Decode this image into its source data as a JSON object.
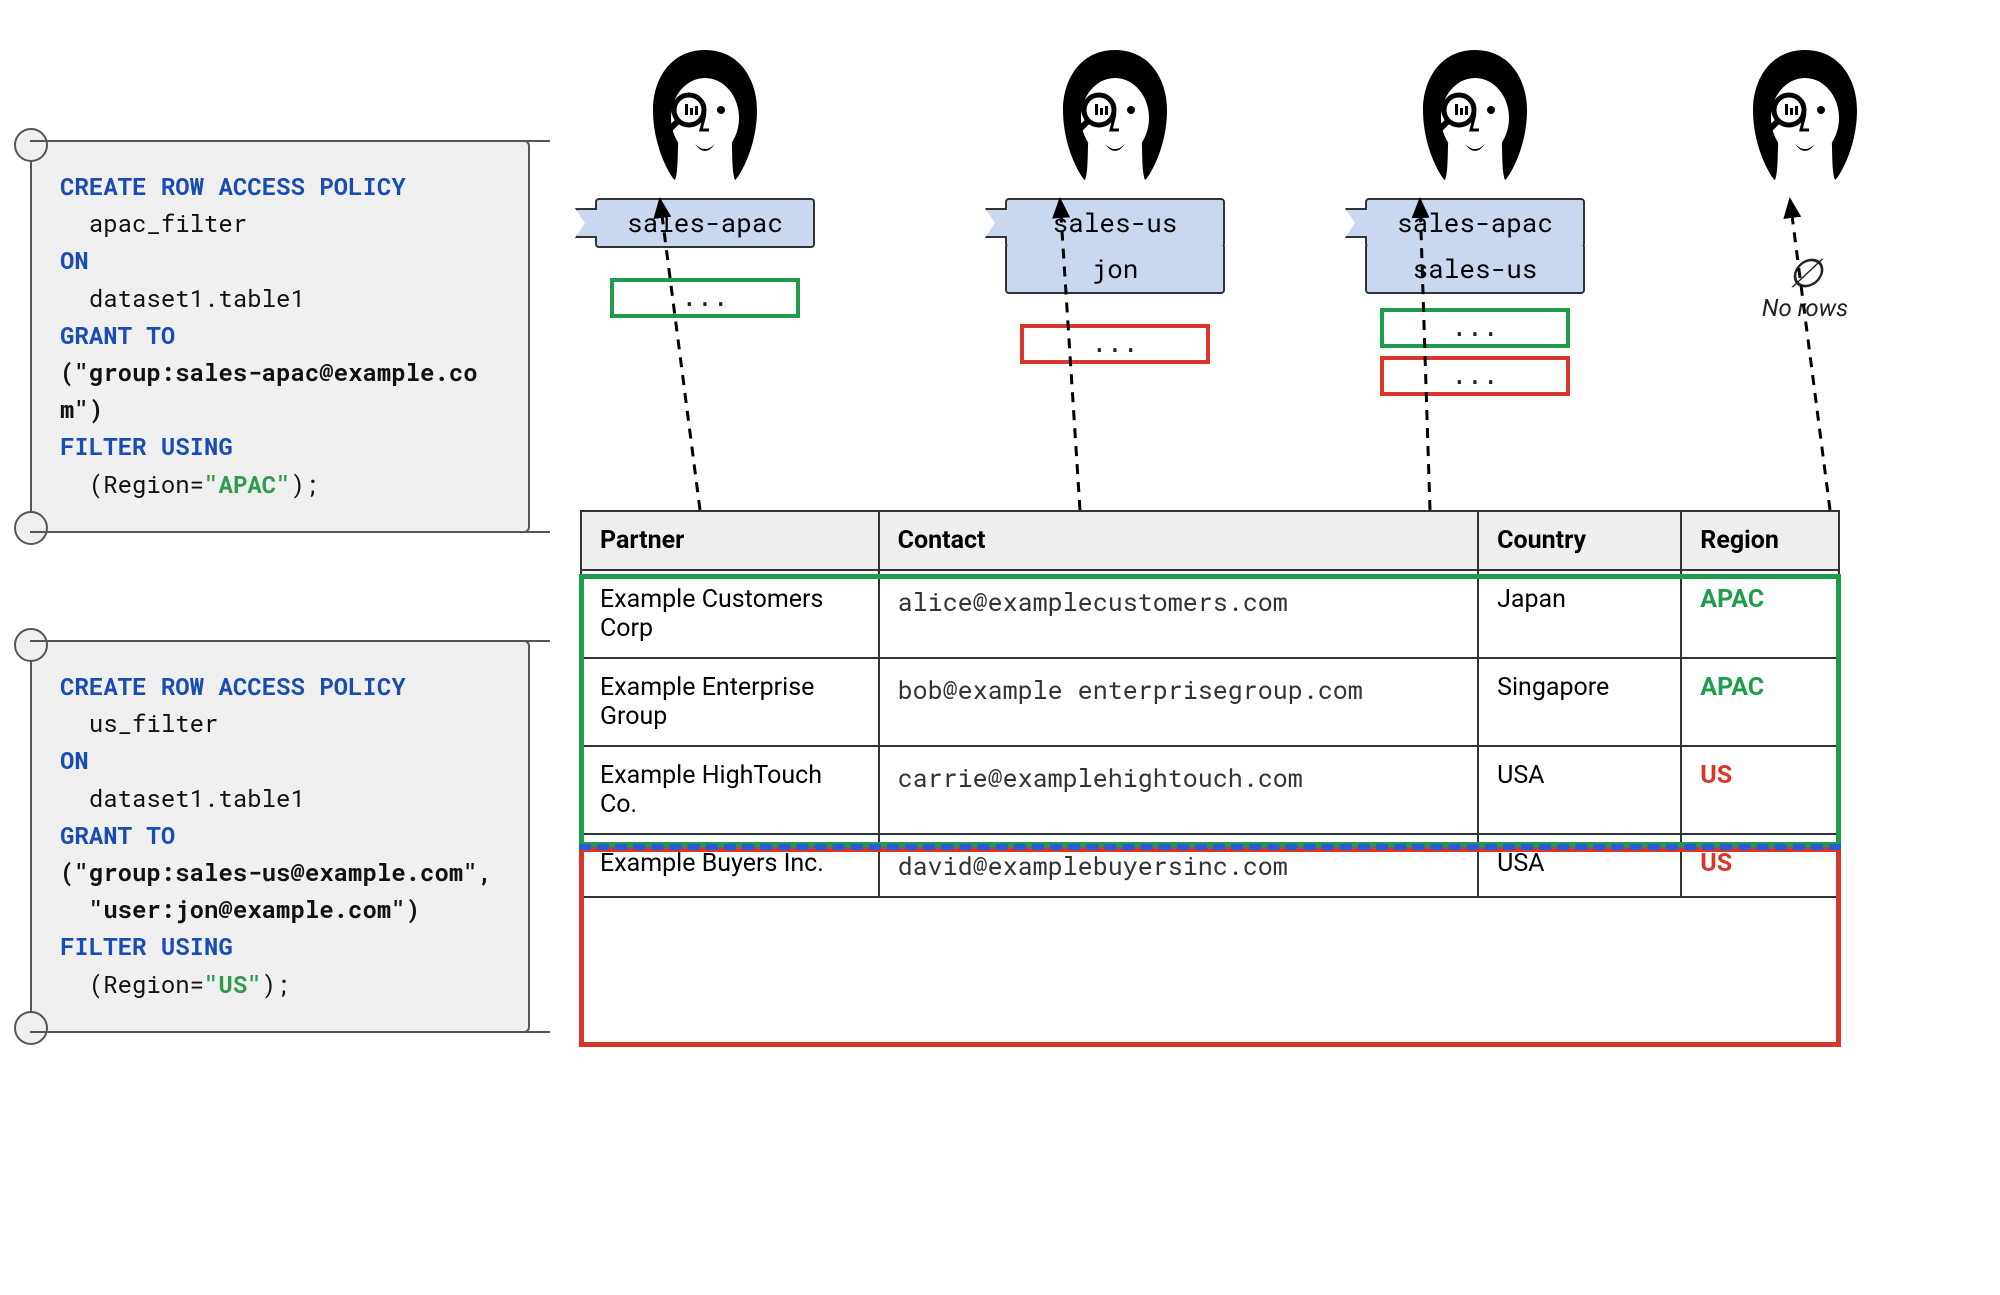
{
  "policies": [
    {
      "create": "CREATE ROW ACCESS POLICY",
      "name": "apac_filter",
      "on_kw": "ON",
      "on_target": "dataset1.table1",
      "grant_kw": "GRANT TO",
      "grant_list": "(\"group:sales-apac@example.com\")",
      "filter_kw": "FILTER USING",
      "filter_expr_open": "(Region=",
      "filter_value": "\"APAC\"",
      "filter_expr_close": ");"
    },
    {
      "create": "CREATE ROW ACCESS POLICY",
      "name": "us_filter",
      "on_kw": "ON",
      "on_target": "dataset1.table1",
      "grant_kw": "GRANT TO",
      "grant_list": "(\"group:sales-us@example.com\",\n  \"user:jon@example.com\")",
      "filter_kw": "FILTER USING",
      "filter_expr_open": "(Region=",
      "filter_value": "\"US\"",
      "filter_expr_close": ");"
    }
  ],
  "personas": [
    {
      "flags": [
        "sales-apac"
      ],
      "rows": [
        {
          "color": "green",
          "label": "..."
        }
      ]
    },
    {
      "flags": [
        "sales-us",
        "jon"
      ],
      "rows": [
        {
          "color": "red",
          "label": "..."
        }
      ]
    },
    {
      "flags": [
        "sales-apac",
        "sales-us"
      ],
      "rows": [
        {
          "color": "green",
          "label": "..."
        },
        {
          "color": "red",
          "label": "..."
        }
      ]
    },
    {
      "flags": [],
      "no_rows_symbol": "∅",
      "no_rows_text": "No rows"
    }
  ],
  "table": {
    "headers": [
      "Partner",
      "Contact",
      "Country",
      "Region"
    ],
    "rows": [
      {
        "partner": "Example Customers Corp",
        "contact": "alice@examplecustomers.com",
        "country": "Japan",
        "region": "APAC",
        "region_class": "apac"
      },
      {
        "partner": "Example Enterprise Group",
        "contact": "bob@example enterprisegroup.com",
        "country": "Singapore",
        "region": "APAC",
        "region_class": "apac"
      },
      {
        "partner": "Example HighTouch Co.",
        "contact": "carrie@examplehightouch.com",
        "country": "USA",
        "region": "US",
        "region_class": "us"
      },
      {
        "partner": "Example Buyers Inc.",
        "contact": "david@examplebuyersinc.com",
        "country": "USA",
        "region": "US",
        "region_class": "us"
      }
    ]
  }
}
